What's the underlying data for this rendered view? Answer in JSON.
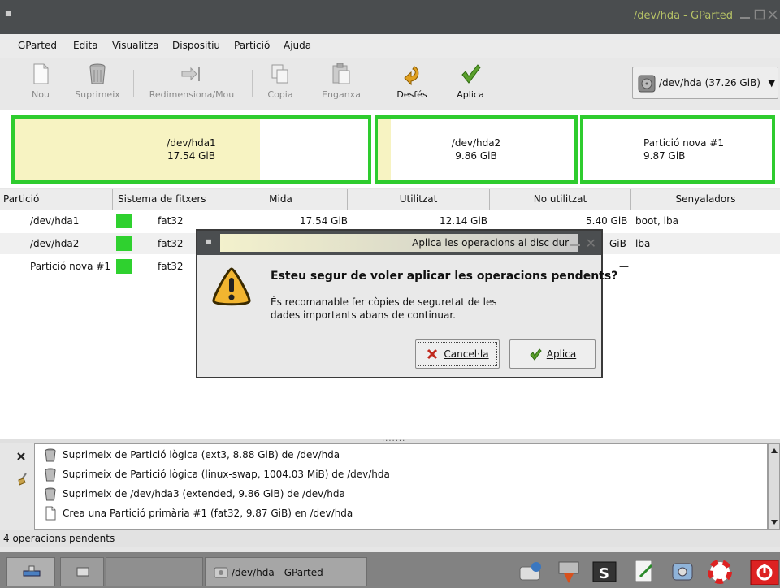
{
  "window": {
    "title": "/dev/hda - GParted"
  },
  "menu": [
    "GParted",
    "Edita",
    "Visualitza",
    "Dispositiu",
    "Partició",
    "Ajuda"
  ],
  "toolbar": {
    "new": "Nou",
    "delete": "Suprimeix",
    "resize": "Redimensiona/Mou",
    "copy": "Copia",
    "paste": "Enganxa",
    "undo": "Desfés",
    "apply": "Aplica"
  },
  "device": {
    "label": "/dev/hda  (37.26 GiB)"
  },
  "diskmap": [
    {
      "name": "/dev/hda1",
      "size": "17.54 GiB"
    },
    {
      "name": "/dev/hda2",
      "size": "9.86 GiB"
    },
    {
      "name": "Partició nova #1",
      "size": "9.87 GiB"
    }
  ],
  "table": {
    "headers": [
      "Partició",
      "Sistema de fitxers",
      "Mida",
      "Utilitzat",
      "No utilitzat",
      "Senyaladors"
    ],
    "rows": [
      {
        "partition": "/dev/hda1",
        "fs": "fat32",
        "size": "17.54 GiB",
        "used": "12.14 GiB",
        "unused": "5.40 GiB",
        "flags": "boot, lba"
      },
      {
        "partition": "/dev/hda2",
        "fs": "fat32",
        "unused": "GiB",
        "flags": "lba"
      },
      {
        "partition": "Partició nova #1",
        "fs": "fat32",
        "unused": "—"
      }
    ]
  },
  "operations": [
    "Suprimeix de Partició lògica (ext3, 8.88 GiB) de /dev/hda",
    "Suprimeix de Partició lògica (linux-swap, 1004.03 MiB) de /dev/hda",
    "Suprimeix de /dev/hda3 (extended, 9.86 GiB) de /dev/hda",
    "Crea una Partició primària #1 (fat32, 9.87 GiB) en /dev/hda"
  ],
  "status": "4 operacions pendents",
  "dialog": {
    "title": "Aplica les operacions al disc dur",
    "heading": "Esteu segur de voler aplicar les operacions pendents?",
    "body": "És recomanable fer còpies de seguretat de les dades importants abans de continuar.",
    "cancel": "Cancel·la",
    "apply": "Aplica"
  },
  "taskbar": {
    "active_window": "/dev/hda - GParted"
  },
  "colors": {
    "partition_border": "#2ecc2e",
    "used_fill": "#f7f3c2",
    "fs_fat32": "#2fd12f"
  }
}
